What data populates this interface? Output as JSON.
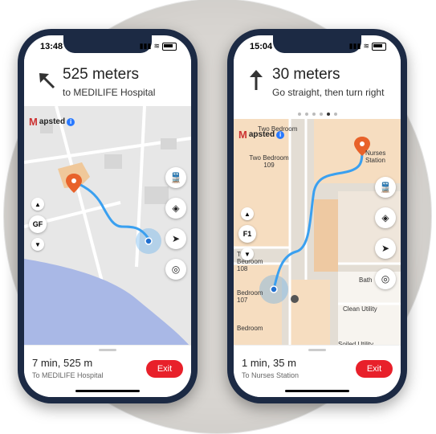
{
  "phone1": {
    "time": "13:48",
    "distance": "525 meters",
    "instruction": "to MEDILIFE Hospital",
    "eta": "7 min, 525 m",
    "destination": "To MEDILIFE Hospital",
    "exit_label": "Exit",
    "floor": "GF",
    "logo": "apsted",
    "logo_mark": "M",
    "info": "i"
  },
  "phone2": {
    "time": "15:04",
    "distance": "30 meters",
    "instruction": "Go straight, then turn right",
    "eta": "1 min, 35 m",
    "destination": "To Nurses Station",
    "exit_label": "Exit",
    "floor": "F1",
    "logo": "apsted",
    "logo_mark": "M",
    "info": "i",
    "rooms": [
      "Two Bedroom",
      "Two Bedroom 109",
      "Nurses Station",
      "Two Bedroom 108",
      "Bedroom 107",
      "Bath",
      "Clean Utility",
      "Bedroom",
      "Soiled Utility"
    ]
  },
  "colors": {
    "route": "#3aa0f0",
    "exit": "#e8202a",
    "frame": "#1c2a44"
  }
}
